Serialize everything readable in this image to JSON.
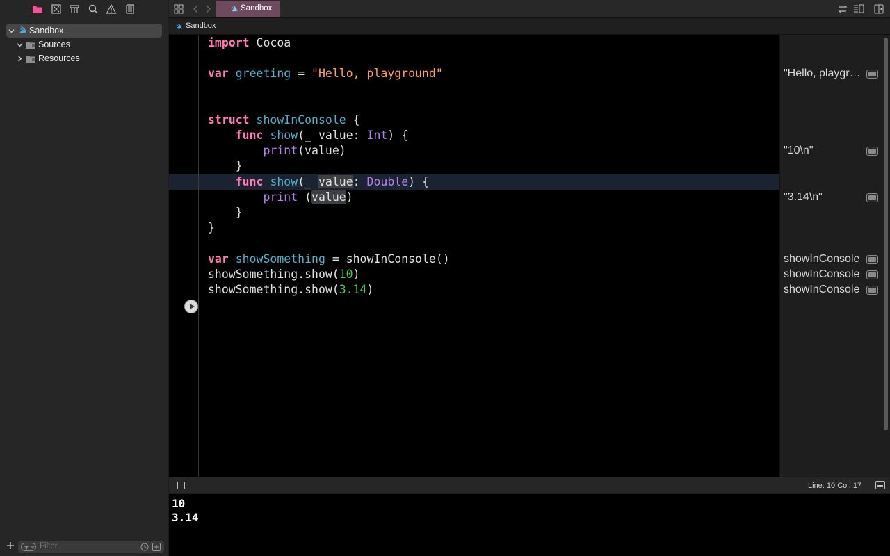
{
  "sidebar": {
    "tree": [
      {
        "label": "Sandbox",
        "expanded": true,
        "icon": "swift-icon"
      },
      {
        "label": "Sources",
        "expanded": true,
        "icon": "folder-icon"
      },
      {
        "label": "Resources",
        "expanded": false,
        "icon": "folder-icon"
      }
    ],
    "filter_placeholder": "Filter"
  },
  "tabbar": {
    "active_tab": "Sandbox"
  },
  "jumpbar": {
    "crumb": "Sandbox"
  },
  "results": [
    {
      "text": "\"Hello, playground\""
    },
    {
      "text": "\"10\\n\""
    },
    {
      "text": "\"3.14\\n\""
    },
    {
      "text": "showInConsole"
    },
    {
      "text": "showInConsole"
    },
    {
      "text": "showInConsole"
    }
  ],
  "status": {
    "position": "Line: 10  Col: 17"
  },
  "console": {
    "output": [
      "10",
      "3.14"
    ]
  },
  "colors": {
    "keyword": "#ff7ab2",
    "type": "#4eb0cc",
    "function": "#b281eb",
    "string": "#ffa14f",
    "number": "#4ec45a",
    "tab_active": "#6e4a5e",
    "navigator_icon_active": "#ff4f9a"
  }
}
